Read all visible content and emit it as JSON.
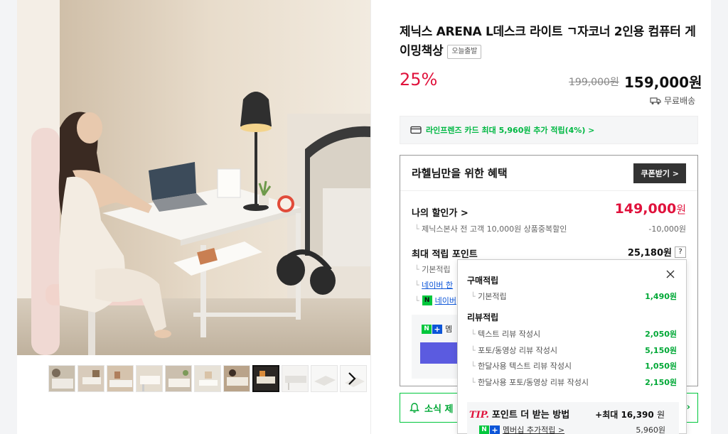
{
  "product": {
    "title": "제닉스 ARENA L데스크 라이트 ㄱ자코너 2인용 컴퓨터 게이밍책상",
    "badge": "오늘출발",
    "discount": "25%",
    "original_price": "199,000원",
    "price": "159,000원",
    "shipping": "무료배송"
  },
  "card_promo": "라인프렌즈 카드 최대 5,960원 추가 적립(4%) >",
  "benefit": {
    "title": "라헬님만을 위한 혜택",
    "coupon_button": "쿠폰받기 >",
    "my_discount_label": "나의 할인가 >",
    "my_discount_value": "149,000",
    "my_discount_unit": "원",
    "sub_discount_label": "제닉스본사 전 고객 10,000원 상품중복할인",
    "sub_discount_value": "-10,000원",
    "max_points_label": "최대 적립 포인트",
    "max_points_value": "25,180원",
    "help": "?",
    "row_basic": "기본적립",
    "row_naver": "네이버 한",
    "row_naver2": "네이버",
    "member_text": "멤"
  },
  "news_bar": "소식 제",
  "popup": {
    "purchase_title": "구매적립",
    "purchase_rows": [
      {
        "label": "기본적립",
        "value": "1,490원"
      }
    ],
    "review_title": "리뷰적립",
    "review_rows": [
      {
        "label": "텍스트 리뷰 작성시",
        "value": "2,050원"
      },
      {
        "label": "포토/동영상 리뷰 작성시",
        "value": "5,150원"
      },
      {
        "label": "한달사용 텍스트 리뷰 작성시",
        "value": "1,050원"
      },
      {
        "label": "한달사용 포토/동영상 리뷰 작성시",
        "value": "2,150원"
      }
    ],
    "tip_label": "TIP.",
    "tip_title": "포인트 더 받는 방법",
    "tip_max": "+최대 16,390",
    "tip_max_unit": "원",
    "tip_row_label": "멤버십 추가적립 >",
    "tip_row_value": "5,960원"
  },
  "colors": {
    "accent_red": "#e0123c",
    "naver_green": "#00c73c",
    "point_green": "#00a836"
  }
}
